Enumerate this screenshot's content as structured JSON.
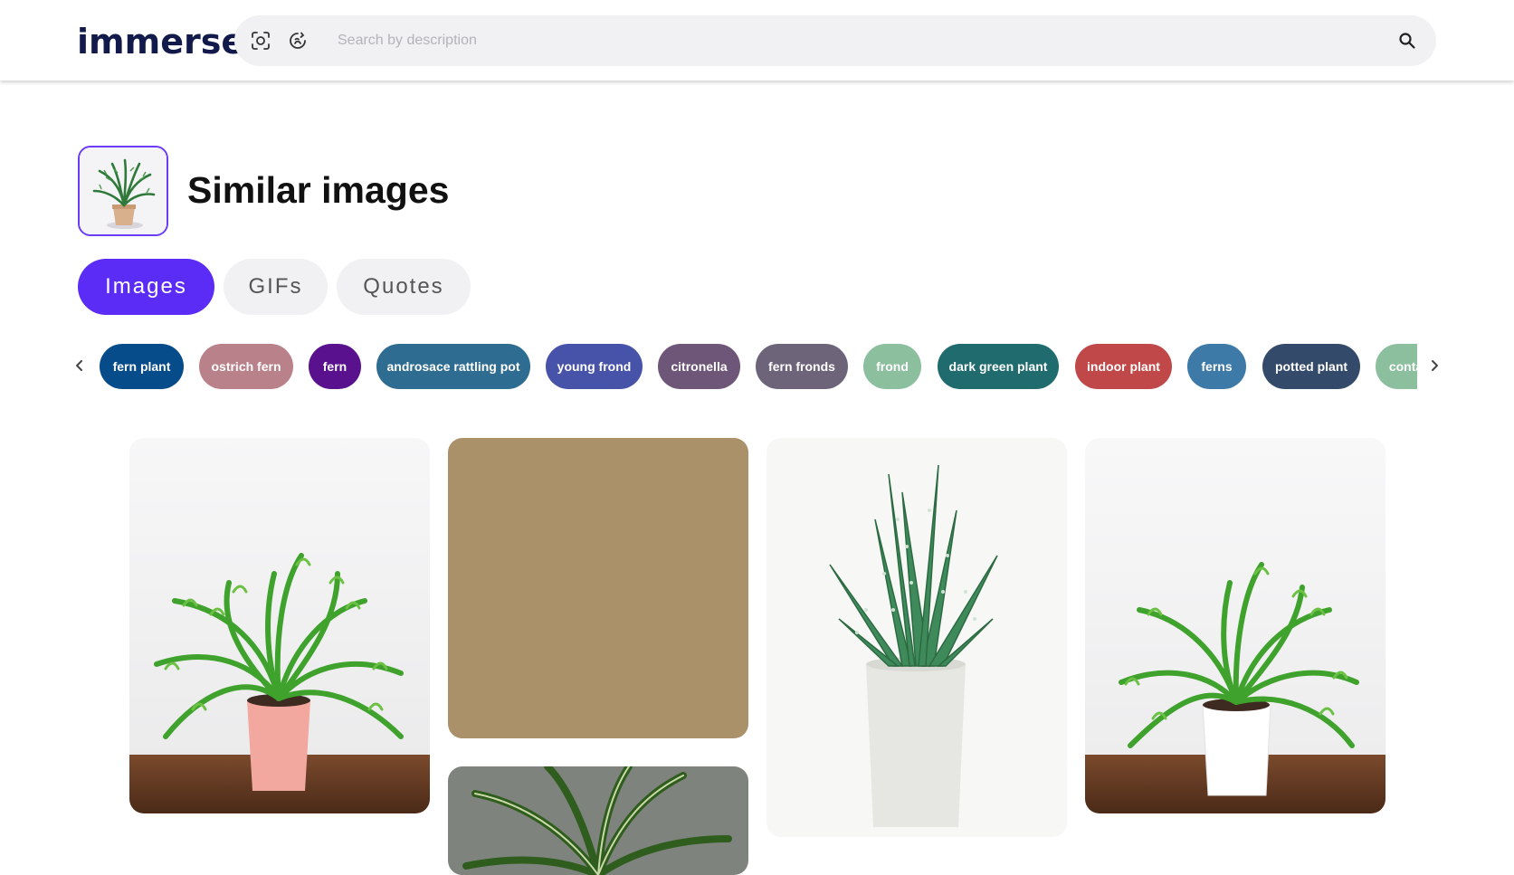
{
  "header": {
    "logo_text": "immerse",
    "search": {
      "placeholder": "Search by description",
      "value": ""
    }
  },
  "main": {
    "title": "Similar images",
    "tabs": [
      {
        "label": "Images",
        "active": true
      },
      {
        "label": "GIFs",
        "active": false
      },
      {
        "label": "Quotes",
        "active": false
      }
    ],
    "tags": [
      {
        "label": "fern plant",
        "color": "#074c8a"
      },
      {
        "label": "ostrich fern",
        "color": "#b98189"
      },
      {
        "label": "fern",
        "color": "#5a118e"
      },
      {
        "label": "androsace rattling pot",
        "color": "#2f6c91"
      },
      {
        "label": "young frond",
        "color": "#4753a9"
      },
      {
        "label": "citronella",
        "color": "#6d5678"
      },
      {
        "label": "fern fronds",
        "color": "#6e6479"
      },
      {
        "label": "frond",
        "color": "#8cbf9e"
      },
      {
        "label": "dark green plant",
        "color": "#1f6b6e"
      },
      {
        "label": "indoor plant",
        "color": "#c14849"
      },
      {
        "label": "ferns",
        "color": "#3d7aa8"
      },
      {
        "label": "potted plant",
        "color": "#344a6b"
      },
      {
        "label": "container plant",
        "color": "#8cbf9e"
      }
    ]
  },
  "colors": {
    "accent": "#5b2cf6",
    "logo": "#111a4a",
    "placeholder_tile": "#ab916a"
  }
}
